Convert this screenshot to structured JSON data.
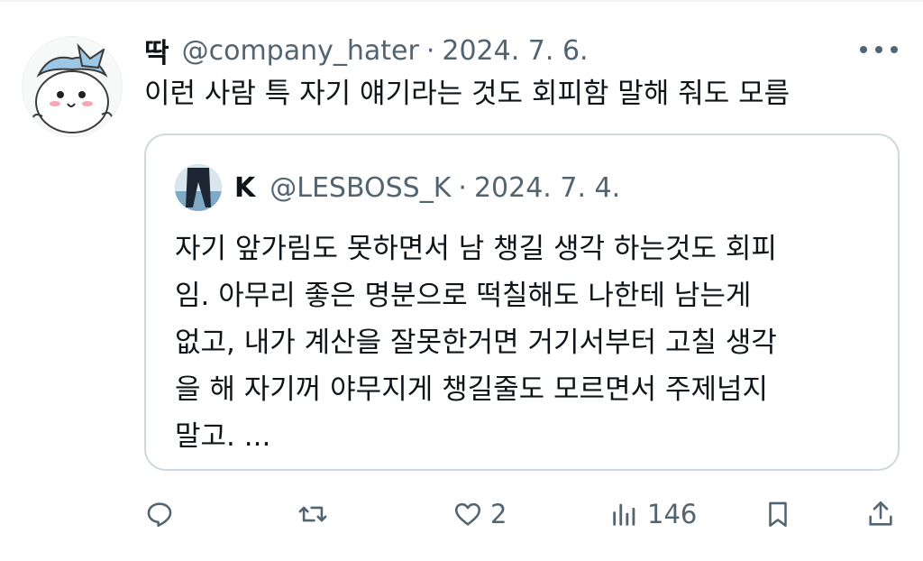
{
  "tweet": {
    "display_name": "딱",
    "handle": "@company_hater",
    "separator": "·",
    "date": "2024. 7. 6.",
    "text": "이런 사람 특 자기 얘기라는 것도 회피함 말해 줘도 모름"
  },
  "quoted_tweet": {
    "display_name": "K",
    "handle": "@LESBOSS_K",
    "separator": "·",
    "date": "2024. 7. 4.",
    "text_lines": [
      "자기 앞가림도 못하면서 남 챙길 생각 하는것도 회피",
      "임. 아무리 좋은 명분으로 떡칠해도 나한테 남는게",
      "없고, 내가 계산을 잘못한거면 거기서부터 고칠 생각",
      "을 해 자기꺼 야무지게 챙길줄도 모르면서 주제넘지",
      "말고. ..."
    ]
  },
  "actions": {
    "reply_icon": "speech-bubble-icon",
    "retweet_icon": "retweet-icon",
    "like_icon": "heart-icon",
    "like_count": "2",
    "views_icon": "bar-chart-icon",
    "views_count": "146",
    "bookmark_icon": "bookmark-icon",
    "share_icon": "share-upload-icon"
  },
  "colors": {
    "text": "#0f1419",
    "secondary": "#536471",
    "border": "#cfd9de"
  }
}
